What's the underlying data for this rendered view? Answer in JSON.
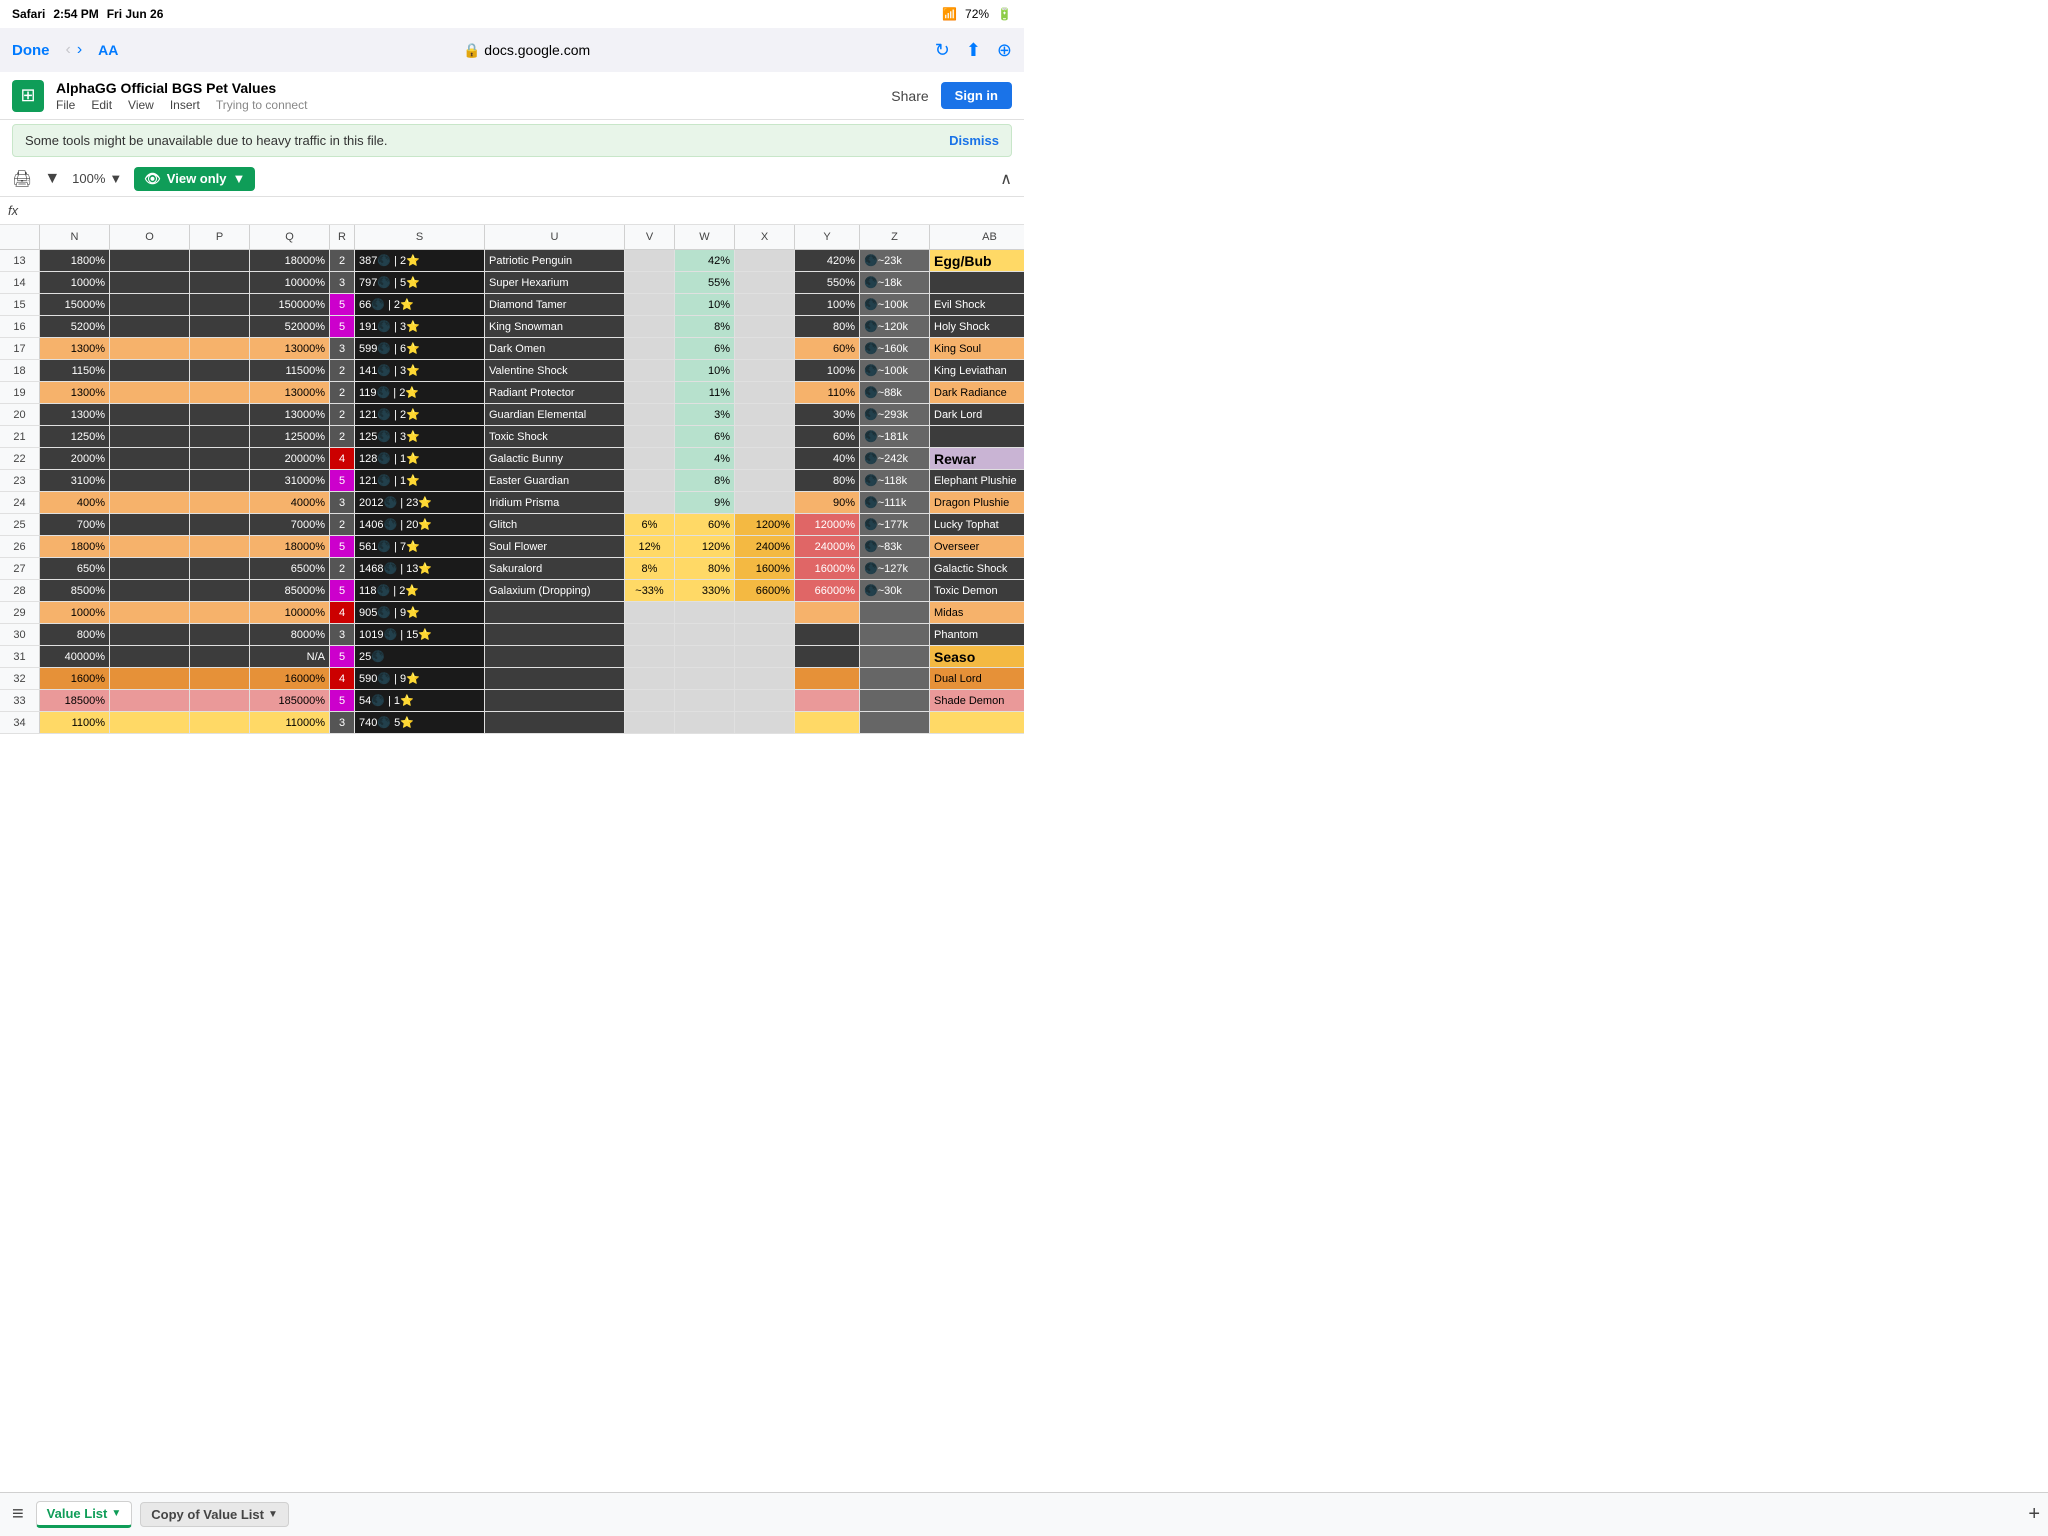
{
  "status_bar": {
    "carrier": "Safari",
    "time": "2:54 PM",
    "date": "Fri Jun 26",
    "wifi": "72%",
    "battery": "72%"
  },
  "browser": {
    "done": "Done",
    "text_size": "AA",
    "url": "docs.google.com",
    "lock": "🔒"
  },
  "doc": {
    "title": "AlphaGG Official BGS Pet Values",
    "menu": [
      "File",
      "Edit",
      "View",
      "Insert"
    ],
    "connection_status": "Trying to connect",
    "share_label": "Share",
    "signin_label": "Sign in"
  },
  "notification": {
    "text": "Some tools might be unavailable due to heavy traffic in this file.",
    "dismiss": "Dismiss"
  },
  "toolbar": {
    "zoom": "100%",
    "view_only": "View only"
  },
  "columns": [
    "N",
    "O",
    "P",
    "Q",
    "R",
    "S",
    "",
    "U",
    "V",
    "W",
    "X",
    "Y",
    "Z",
    "",
    "AB"
  ],
  "rows": [
    {
      "row": 13,
      "n": "1800%",
      "o": "",
      "p": "",
      "q": "18000%",
      "r": "2",
      "r_color": "dark",
      "s": "387🌑 | 2⭐",
      "u": "Patriotic Penguin",
      "v": "",
      "w": "42%",
      "x": "",
      "y": "420%",
      "z": "🌑~23k",
      "ab": "Egg/Bub",
      "ab_class": "egg",
      "row_class": "dark"
    },
    {
      "row": 14,
      "n": "1000%",
      "o": "",
      "p": "",
      "q": "10000%",
      "r": "3",
      "r_color": "dark",
      "s": "797🌑 | 5⭐",
      "u": "Super Hexarium",
      "v": "",
      "w": "55%",
      "x": "",
      "y": "550%",
      "z": "🌑~18k",
      "ab": "",
      "row_class": "dark"
    },
    {
      "row": 15,
      "n": "15000%",
      "o": "",
      "p": "",
      "q": "150000%",
      "r": "5",
      "r_color": "magenta",
      "s": "66🌑 | 2⭐",
      "u": "Diamond Tamer",
      "v": "",
      "w": "10%",
      "x": "",
      "y": "100%",
      "z": "🌑~100k",
      "ab": "Evil Shock",
      "row_class": "dark"
    },
    {
      "row": 16,
      "n": "5200%",
      "o": "",
      "p": "",
      "q": "52000%",
      "r": "5",
      "r_color": "magenta",
      "s": "191🌑 | 3⭐",
      "u": "King Snowman",
      "v": "",
      "w": "8%",
      "x": "",
      "y": "80%",
      "z": "🌑~120k",
      "ab": "Holy Shock",
      "row_class": "dark"
    },
    {
      "row": 17,
      "n": "1300%",
      "o": "",
      "p": "",
      "q": "13000%",
      "r": "3",
      "r_color": "dark",
      "s": "599🌑 | 6⭐",
      "u": "Dark Omen",
      "v": "",
      "w": "6%",
      "x": "",
      "y": "60%",
      "z": "🌑~160k",
      "ab": "King Soul",
      "row_class": "gold"
    },
    {
      "row": 18,
      "n": "1150%",
      "o": "",
      "p": "",
      "q": "11500%",
      "r": "2",
      "r_color": "dark",
      "s": "141🌑 | 3⭐",
      "u": "Valentine Shock",
      "v": "",
      "w": "10%",
      "x": "",
      "y": "100%",
      "z": "🌑~100k",
      "ab": "King Leviathan",
      "row_class": "dark"
    },
    {
      "row": 19,
      "n": "1300%",
      "o": "",
      "p": "",
      "q": "13000%",
      "r": "2",
      "r_color": "dark",
      "s": "119🌑 | 2⭐",
      "u": "Radiant Protector",
      "v": "",
      "w": "11%",
      "x": "",
      "y": "110%",
      "z": "🌑~88k",
      "ab": "Dark Radiance",
      "row_class": "gold"
    },
    {
      "row": 20,
      "n": "1300%",
      "o": "",
      "p": "",
      "q": "13000%",
      "r": "2",
      "r_color": "dark",
      "s": "121🌑 | 2⭐",
      "u": "Guardian Elemental",
      "v": "",
      "w": "3%",
      "x": "",
      "y": "30%",
      "z": "🌑~293k",
      "ab": "Dark Lord",
      "row_class": "dark"
    },
    {
      "row": 21,
      "n": "1250%",
      "o": "",
      "p": "",
      "q": "12500%",
      "r": "2",
      "r_color": "dark",
      "s": "125🌑 | 3⭐",
      "u": "Toxic Shock",
      "v": "",
      "w": "6%",
      "x": "",
      "y": "60%",
      "z": "🌑~181k",
      "ab": "",
      "row_class": "dark"
    },
    {
      "row": 22,
      "n": "2000%",
      "o": "",
      "p": "",
      "q": "20000%",
      "r": "4",
      "r_color": "red",
      "s": "128🌑 | 1⭐",
      "u": "Galactic Bunny",
      "v": "",
      "w": "4%",
      "x": "",
      "y": "40%",
      "z": "🌑~242k",
      "ab": "Rewar",
      "ab_class": "reward",
      "row_class": "dark"
    },
    {
      "row": 23,
      "n": "3100%",
      "o": "",
      "p": "",
      "q": "31000%",
      "r": "5",
      "r_color": "magenta",
      "s": "121🌑 | 1⭐",
      "u": "Easter Guardian",
      "v": "",
      "w": "8%",
      "x": "",
      "y": "80%",
      "z": "🌑~118k",
      "ab": "Elephant Plushie",
      "row_class": "dark"
    },
    {
      "row": 24,
      "n": "400%",
      "o": "",
      "p": "",
      "q": "4000%",
      "r": "3",
      "r_color": "dark",
      "s": "2012🌑 | 23⭐",
      "u": "Iridium Prisma",
      "v": "",
      "w": "9%",
      "x": "",
      "y": "90%",
      "z": "🌑~111k",
      "ab": "Dragon Plushie",
      "row_class": "gold"
    },
    {
      "row": 25,
      "n": "700%",
      "o": "",
      "p": "",
      "q": "7000%",
      "r": "2",
      "r_color": "dark",
      "s": "1406🌑 | 20⭐",
      "u": "Glitch",
      "v": "6%",
      "w": "60%",
      "x": "1200%",
      "y": "12000%",
      "z": "🌑~177k",
      "ab": "Lucky Tophat",
      "row_class": "dark"
    },
    {
      "row": 26,
      "n": "1800%",
      "o": "",
      "p": "",
      "q": "18000%",
      "r": "5",
      "r_color": "magenta",
      "s": "561🌑 | 7⭐",
      "u": "Soul Flower",
      "v": "12%",
      "w": "120%",
      "x": "2400%",
      "y": "24000%",
      "z": "🌑~83k",
      "ab": "Overseer",
      "row_class": "gold"
    },
    {
      "row": 27,
      "n": "650%",
      "o": "",
      "p": "",
      "q": "6500%",
      "r": "2",
      "r_color": "dark",
      "s": "1468🌑 | 13⭐",
      "u": "Sakuralord",
      "v": "8%",
      "w": "80%",
      "x": "1600%",
      "y": "16000%",
      "z": "🌑~127k",
      "ab": "Galactic Shock",
      "row_class": "dark"
    },
    {
      "row": 28,
      "n": "8500%",
      "o": "",
      "p": "",
      "q": "85000%",
      "r": "5",
      "r_color": "magenta",
      "s": "118🌑 | 2⭐",
      "u": "Galaxium (Dropping)",
      "v": "~33%",
      "w": "330%",
      "x": "6600%",
      "y": "66000%",
      "z": "🌑~30k",
      "ab": "Toxic Demon",
      "row_class": "dark"
    },
    {
      "row": 29,
      "n": "1000%",
      "o": "",
      "p": "",
      "q": "10000%",
      "r": "4",
      "r_color": "red",
      "s": "905🌑 | 9⭐",
      "u": "",
      "v": "",
      "w": "",
      "x": "",
      "y": "",
      "z": "",
      "ab": "Midas",
      "row_class": "gold"
    },
    {
      "row": 30,
      "n": "800%",
      "o": "",
      "p": "",
      "q": "8000%",
      "r": "3",
      "r_color": "dark",
      "s": "1019🌑 | 15⭐",
      "u": "",
      "v": "",
      "w": "",
      "x": "",
      "y": "",
      "z": "",
      "ab": "Phantom",
      "row_class": "dark"
    },
    {
      "row": 31,
      "n": "40000%",
      "o": "",
      "p": "",
      "q": "N/A",
      "r": "5",
      "r_color": "magenta",
      "s": "25🌑",
      "u": "",
      "v": "",
      "w": "",
      "x": "",
      "y": "",
      "z": "",
      "ab": "Seaso",
      "ab_class": "season",
      "row_class": "dark"
    },
    {
      "row": 32,
      "n": "1600%",
      "o": "",
      "p": "",
      "q": "16000%",
      "r": "4",
      "r_color": "red",
      "s": "590🌑 | 9⭐",
      "u": "",
      "v": "",
      "w": "",
      "x": "",
      "y": "",
      "z": "",
      "ab": "Dual Lord",
      "row_class": "orange"
    },
    {
      "row": 33,
      "n": "18500%",
      "o": "",
      "p": "",
      "q": "185000%",
      "r": "5",
      "r_color": "magenta",
      "s": "54🌑 | 1⭐",
      "u": "",
      "v": "",
      "w": "",
      "x": "",
      "y": "",
      "z": "",
      "ab": "Shade Demon",
      "row_class": "salmon"
    },
    {
      "row": 34,
      "n": "1100%",
      "o": "",
      "p": "",
      "q": "11000%",
      "r": "3",
      "r_color": "dark",
      "s": "740🌑 5⭐",
      "u": "",
      "v": "",
      "w": "",
      "x": "",
      "y": "",
      "z": "",
      "ab": "",
      "row_class": "yellow"
    }
  ],
  "tabs": {
    "active": "Value List",
    "inactive": "Copy of Value List",
    "add_label": "+"
  }
}
